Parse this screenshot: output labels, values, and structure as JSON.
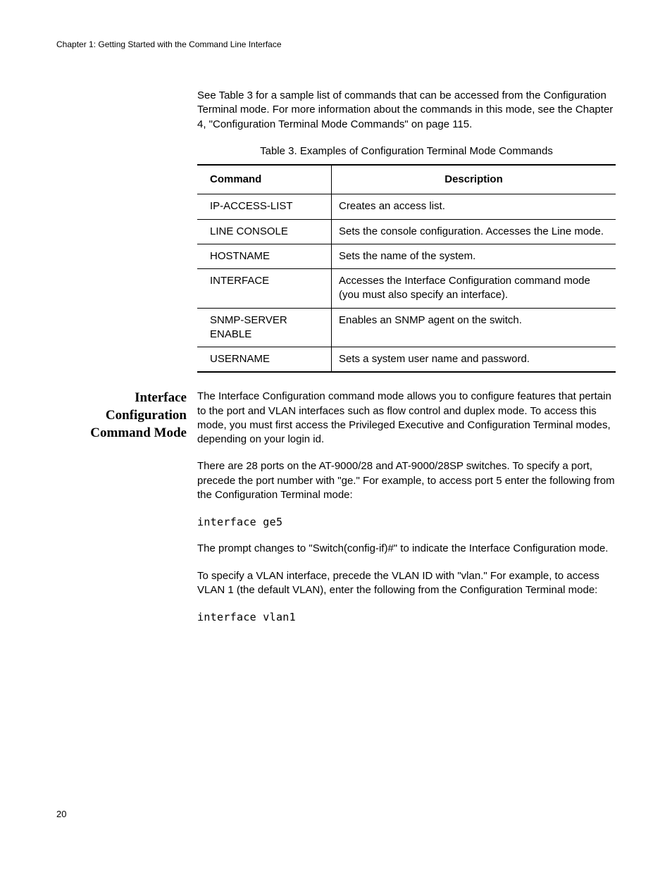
{
  "header": {
    "chapter": "Chapter 1: Getting Started with the Command Line Interface"
  },
  "intro": {
    "text": "See Table 3 for a sample list of commands that can be accessed from the Configuration Terminal mode. For more information about the commands in this mode, see the Chapter 4, \"Configuration Terminal Mode Commands\" on page 115."
  },
  "table": {
    "caption": "Table 3. Examples of Configuration Terminal Mode Commands",
    "headers": {
      "command": "Command",
      "description": "Description"
    },
    "rows": [
      {
        "command": "IP-ACCESS-LIST",
        "description": "Creates an access list."
      },
      {
        "command": "LINE CONSOLE",
        "description": "Sets the console configuration. Accesses the Line mode."
      },
      {
        "command": "HOSTNAME",
        "description": "Sets the name of the system."
      },
      {
        "command": "INTERFACE",
        "description": "Accesses the Interface Configuration command mode (you must also specify an interface)."
      },
      {
        "command": "SNMP-SERVER ENABLE",
        "description": "Enables an SNMP agent on the switch."
      },
      {
        "command": "USERNAME",
        "description": "Sets a system user name and password."
      }
    ]
  },
  "section": {
    "heading": "Interface Configuration Command Mode",
    "para1": "The Interface Configuration command mode allows you to configure features that pertain to the port and VLAN interfaces such as flow control and duplex mode. To access this mode, you must first access the Privileged Executive and Configuration Terminal modes, depending on your login id.",
    "para2": "There are 28 ports on the AT-9000/28 and AT-9000/28SP switches. To specify a port, precede the port number with \"ge.\" For example, to access port 5 enter the following from the Configuration Terminal mode:",
    "code1": "interface ge5",
    "para3": "The prompt changes to \"Switch(config-if)#\" to indicate the Interface Configuration mode.",
    "para4": "To specify a VLAN interface, precede the VLAN ID with \"vlan.\" For example, to access VLAN 1 (the default VLAN), enter the following from the Configuration Terminal mode:",
    "code2": "interface vlan1"
  },
  "page_number": "20"
}
